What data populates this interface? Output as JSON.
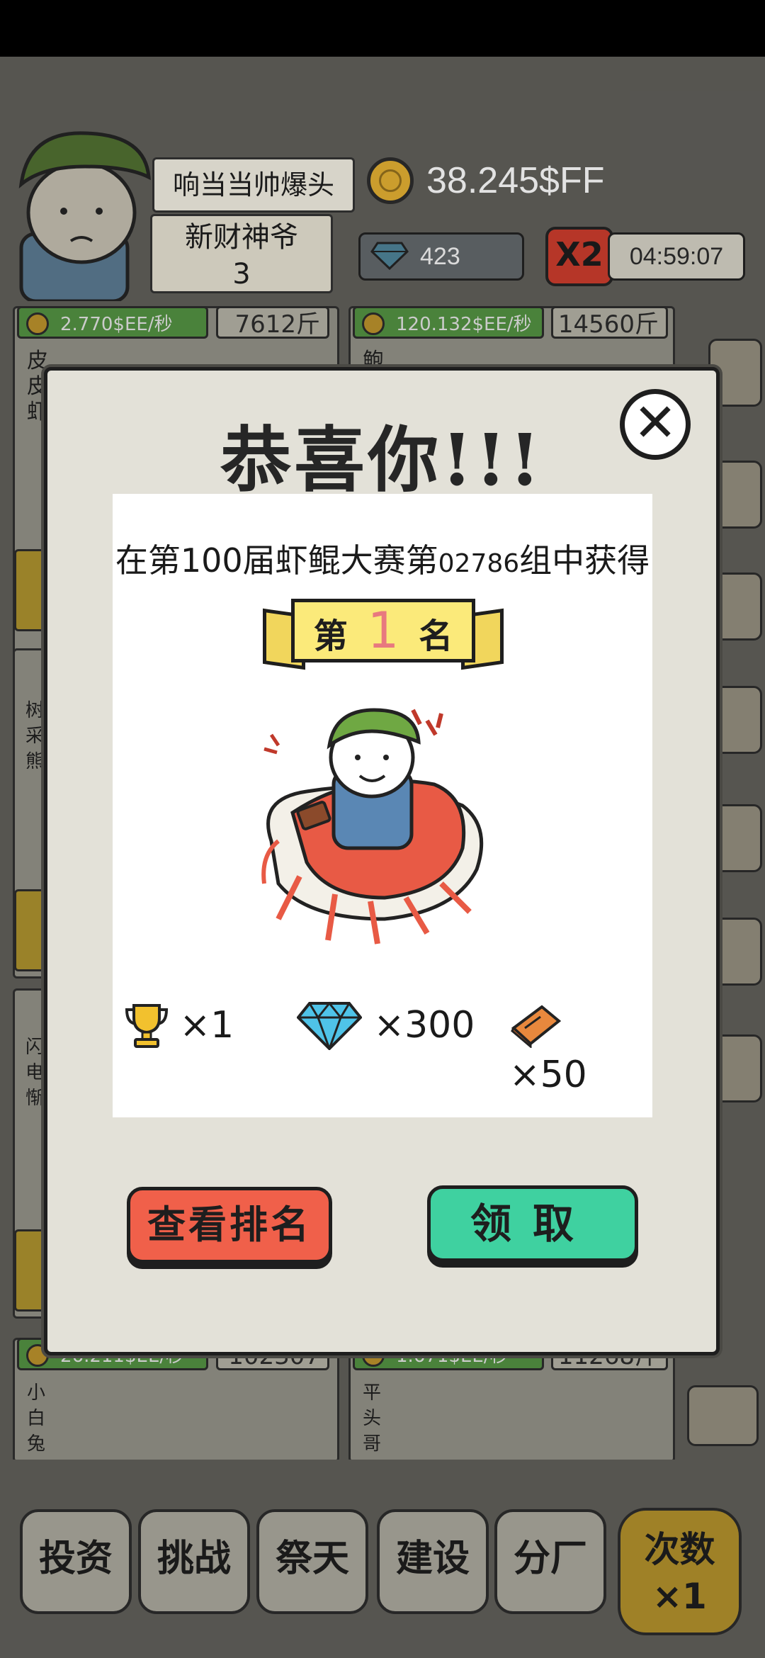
{
  "header": {
    "player_name": "响当当帅爆头",
    "player_title": "新财神爷",
    "player_level": "3",
    "gold": "38.245$FF",
    "gems": "423",
    "multiplier": "X2",
    "timer": "04:59:07"
  },
  "cards": [
    {
      "rate": "2.770$EE/秒",
      "weight": "7612斤",
      "name": "皮皮虾"
    },
    {
      "rate": "120.132$EE/秒",
      "weight": "14560斤",
      "name": "鲍"
    },
    {
      "rate": "26.211$EE/秒",
      "weight": "102307",
      "name": "小白兔"
    },
    {
      "rate": "1.671$EE/秒",
      "weight": "11268斤",
      "name": "平头哥"
    }
  ],
  "side_names": [
    "树采熊",
    "闪电惭"
  ],
  "bottom_nav": {
    "items": [
      "投资",
      "挑战",
      "祭天",
      "建设",
      "分厂"
    ],
    "special_label": "次数",
    "special_count": "×1"
  },
  "dialog": {
    "title": "恭喜你!!!",
    "close_symbol": "✕",
    "result_prefix": "在第100届虾鲲大赛第",
    "group_number": "02786",
    "result_suffix": "组中获得",
    "rank_prefix": "第",
    "rank_number": "1",
    "rank_suffix": "名",
    "rewards": [
      {
        "icon": "trophy-icon",
        "amount": "×1"
      },
      {
        "icon": "diamond-icon",
        "amount": "×300"
      },
      {
        "icon": "brick-icon",
        "amount": "×50"
      }
    ],
    "view_ranking_label": "查看排名",
    "claim_label": "领取"
  },
  "colors": {
    "dialog_bg": "#e3e1d8",
    "rank_ribbon": "#fbea7a",
    "rank_number": "#e8797f",
    "view_ranking_button": "#f0604a",
    "claim_button": "#3fd1a0",
    "gold_coin": "#d6a630",
    "diamond": "#4fc3e8"
  }
}
